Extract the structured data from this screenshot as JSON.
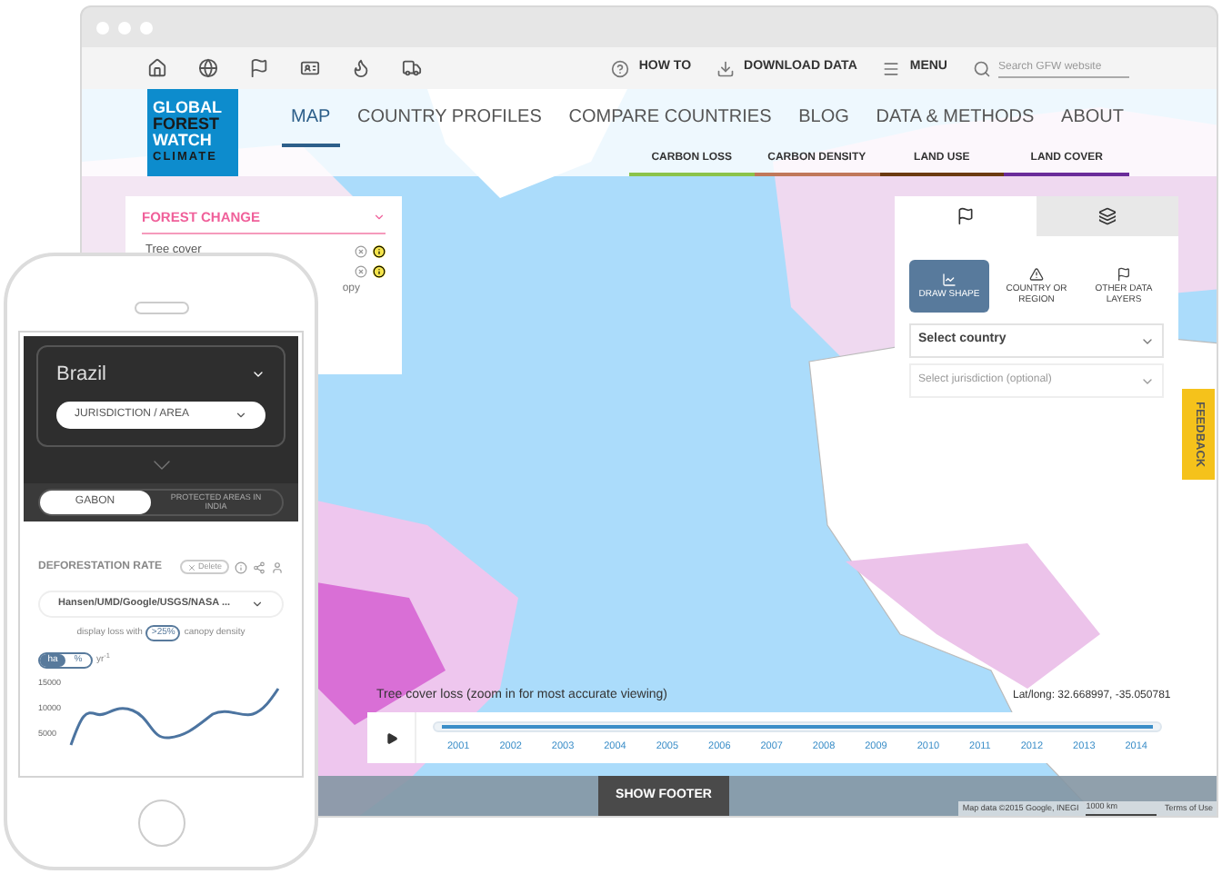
{
  "toolbar": {
    "links": [
      {
        "kind": "help",
        "label": "HOW TO"
      },
      {
        "kind": "download",
        "label": "DOWNLOAD DATA"
      },
      {
        "kind": "menu",
        "label": "MENU"
      }
    ],
    "search": {
      "placeholder": "Search GFW website"
    }
  },
  "logo": {
    "lines": [
      "GLOBAL",
      "FOREST",
      "WATCH",
      "CLIMATE"
    ]
  },
  "nav": [
    {
      "label": "MAP",
      "selected": true
    },
    {
      "label": "COUNTRY PROFILES",
      "selected": false
    },
    {
      "label": "COMPARE COUNTRIES",
      "selected": false
    },
    {
      "label": "BLOG",
      "selected": false
    },
    {
      "label": "DATA & METHODS",
      "selected": false
    },
    {
      "label": "ABOUT",
      "selected": false
    }
  ],
  "layer_tabs": [
    {
      "label": "CARBON LOSS",
      "color": "#8bc34a"
    },
    {
      "label": "CARBON DENSITY",
      "color": "#c0785a"
    },
    {
      "label": "LAND USE",
      "color": "#6b3a10"
    },
    {
      "label": "LAND COVER",
      "color": "#6a2c9a"
    }
  ],
  "forest_change": {
    "title": "FOREST CHANGE",
    "item": "Tree cover",
    "fragment": "opy"
  },
  "analysis_panel": {
    "tabs": [
      {
        "kind": "analysis",
        "selected": true
      },
      {
        "kind": "layers",
        "selected": false
      }
    ],
    "modes": [
      {
        "kind": "draw",
        "label": "DRAW SHAPE",
        "selected": true
      },
      {
        "kind": "region",
        "label": "COUNTRY OR REGION",
        "selected": false
      },
      {
        "kind": "layers",
        "label": "OTHER DATA LAYERS",
        "selected": false
      }
    ],
    "country_select": {
      "placeholder": "Select country"
    },
    "jurisdiction_select": {
      "placeholder": "Select jurisdiction (optional)",
      "disabled": true
    }
  },
  "feedback": "FEEDBACK",
  "map": {
    "layer_caption": "Tree cover loss (zoom in for most accurate viewing)",
    "coordinates": "Lat/long: 32.668997, -35.050781",
    "attribution": "Map data ©2015 Google, INEGI",
    "scale": "1000 km",
    "terms": "Terms of Use"
  },
  "timeline": {
    "level": 1,
    "years": [
      "2001",
      "2002",
      "2003",
      "2004",
      "2005",
      "2006",
      "2007",
      "2008",
      "2009",
      "2010",
      "2011",
      "2012",
      "2013",
      "2014"
    ]
  },
  "footer_button": "SHOW FOOTER",
  "phone": {
    "country": "Brazil",
    "area_select": "JURISDICTION / AREA",
    "toggle": [
      {
        "label": "GABON",
        "selected": true
      },
      {
        "label": "PROTECTED AREAS IN INDIA",
        "selected": false
      }
    ],
    "widget": {
      "title": "DEFORESTATION RATE",
      "delete": "Delete",
      "source": "Hansen/UMD/Google/USGS/NASA ...",
      "density_before": "display loss with",
      "density": ">25%",
      "density_after": "canopy density",
      "units": [
        {
          "label": "ha",
          "selected": true
        },
        {
          "label": "%",
          "selected": false
        }
      ],
      "unit_suffix": "yr$^{-1}$",
      "y_labels": [
        "15000",
        "10000",
        "5000"
      ]
    }
  }
}
